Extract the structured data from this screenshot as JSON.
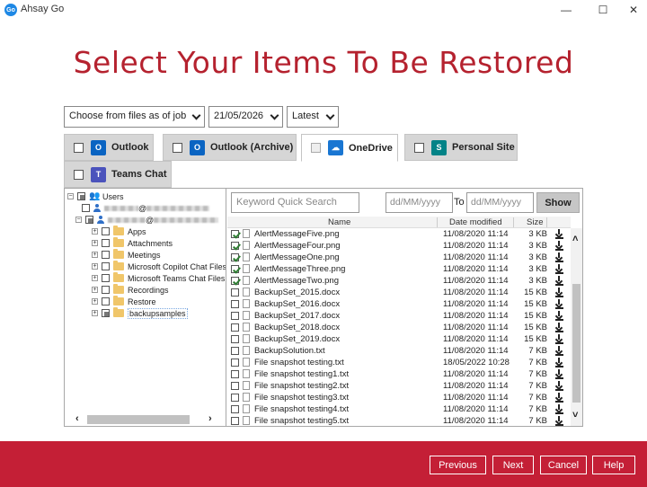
{
  "window": {
    "app_logo_text": "Go",
    "title": "Ahsay Go",
    "minimize": "—",
    "maximize": "☐",
    "close": "✕"
  },
  "page_title": "Select Your Items To Be Restored",
  "filters": {
    "mode": "Choose from files as of job",
    "date": "21/05/2026",
    "version": "Latest"
  },
  "tabs": [
    {
      "label": "Outlook",
      "icon": "outlook-icon",
      "color": "#0a64c2",
      "active": false
    },
    {
      "label": "Outlook (Archive)",
      "icon": "outlook-archive-icon",
      "color": "#0a64c2",
      "active": false
    },
    {
      "label": "OneDrive",
      "icon": "onedrive-icon",
      "color": "#1976d2",
      "active": true
    },
    {
      "label": "Personal Site",
      "icon": "sharepoint-icon",
      "color": "#038387",
      "active": false
    },
    {
      "label": "Teams Chat",
      "icon": "teams-icon",
      "color": "#4b53bc",
      "active": false
    }
  ],
  "tree": {
    "root_label": "Users",
    "folders": [
      "Apps",
      "Attachments",
      "Meetings",
      "Microsoft Copilot Chat Files",
      "Microsoft Teams Chat Files",
      "Recordings",
      "Restore",
      "backupsamples"
    ]
  },
  "search": {
    "placeholder": "Keyword Quick Search",
    "from_placeholder": "dd/MM/yyyy",
    "to_label": "To",
    "to_placeholder": "dd/MM/yyyy",
    "show_label": "Show"
  },
  "columns": {
    "name": "Name",
    "date": "Date modified",
    "size": "Size"
  },
  "files": [
    {
      "name": "AlertMessageFive.png",
      "date": "11/08/2020 11:14",
      "size": "3 KB",
      "checked": true
    },
    {
      "name": "AlertMessageFour.png",
      "date": "11/08/2020 11:14",
      "size": "3 KB",
      "checked": true
    },
    {
      "name": "AlertMessageOne.png",
      "date": "11/08/2020 11:14",
      "size": "3 KB",
      "checked": true
    },
    {
      "name": "AlertMessageThree.png",
      "date": "11/08/2020 11:14",
      "size": "3 KB",
      "checked": true
    },
    {
      "name": "AlertMessageTwo.png",
      "date": "11/08/2020 11:14",
      "size": "3 KB",
      "checked": true
    },
    {
      "name": "BackupSet_2015.docx",
      "date": "11/08/2020 11:14",
      "size": "15 KB",
      "checked": false
    },
    {
      "name": "BackupSet_2016.docx",
      "date": "11/08/2020 11:14",
      "size": "15 KB",
      "checked": false
    },
    {
      "name": "BackupSet_2017.docx",
      "date": "11/08/2020 11:14",
      "size": "15 KB",
      "checked": false
    },
    {
      "name": "BackupSet_2018.docx",
      "date": "11/08/2020 11:14",
      "size": "15 KB",
      "checked": false
    },
    {
      "name": "BackupSet_2019.docx",
      "date": "11/08/2020 11:14",
      "size": "15 KB",
      "checked": false
    },
    {
      "name": "BackupSolution.txt",
      "date": "11/08/2020 11:14",
      "size": "7 KB",
      "checked": false
    },
    {
      "name": "File snapshot testing.txt",
      "date": "18/05/2022 10:28",
      "size": "7 KB",
      "checked": false
    },
    {
      "name": "File snapshot testing1.txt",
      "date": "11/08/2020 11:14",
      "size": "7 KB",
      "checked": false
    },
    {
      "name": "File snapshot testing2.txt",
      "date": "11/08/2020 11:14",
      "size": "7 KB",
      "checked": false
    },
    {
      "name": "File snapshot testing3.txt",
      "date": "11/08/2020 11:14",
      "size": "7 KB",
      "checked": false
    },
    {
      "name": "File snapshot testing4.txt",
      "date": "11/08/2020 11:14",
      "size": "7 KB",
      "checked": false
    },
    {
      "name": "File snapshot testing5.txt",
      "date": "11/08/2020 11:14",
      "size": "7 KB",
      "checked": false
    }
  ],
  "footer": {
    "previous": "Previous",
    "next": "Next",
    "cancel": "Cancel",
    "help": "Help",
    "color": "#c41f36"
  },
  "accent_color": "#b5222f"
}
